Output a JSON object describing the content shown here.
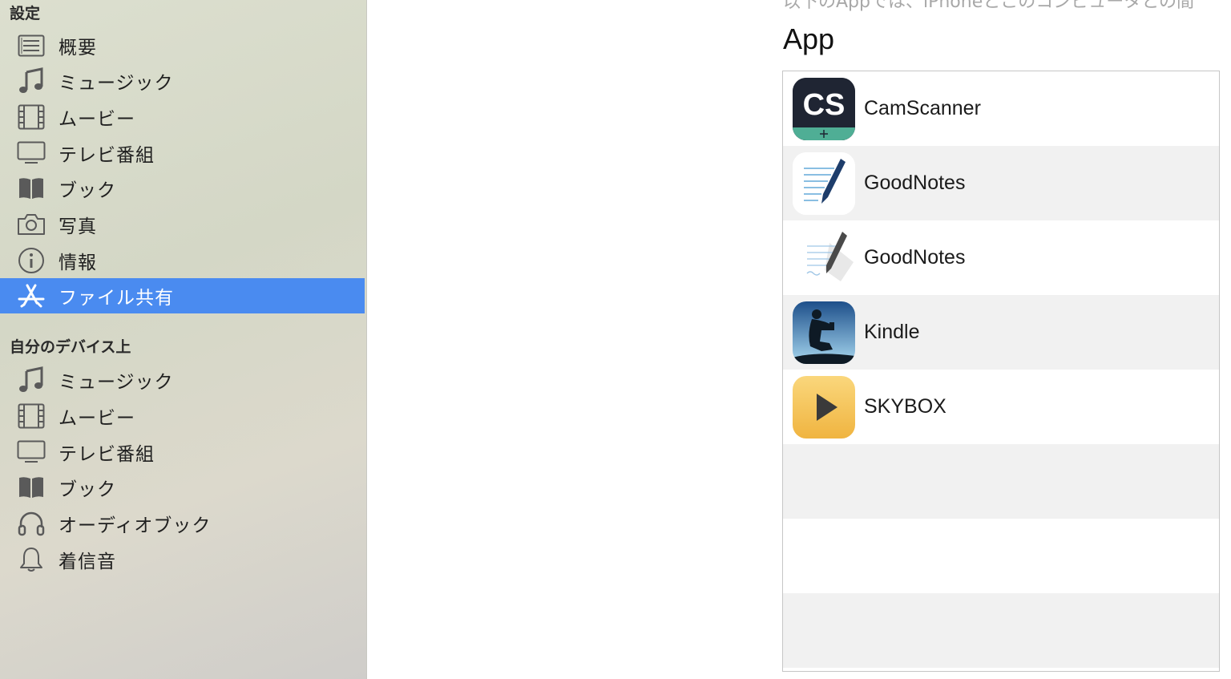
{
  "sidebar": {
    "settings_header": "設定",
    "settings_items": [
      {
        "label": "概要",
        "icon": "list-icon"
      },
      {
        "label": "ミュージック",
        "icon": "music-note-icon"
      },
      {
        "label": "ムービー",
        "icon": "film-icon"
      },
      {
        "label": "テレビ番組",
        "icon": "tv-icon"
      },
      {
        "label": "ブック",
        "icon": "book-icon"
      },
      {
        "label": "写真",
        "icon": "camera-icon"
      },
      {
        "label": "情報",
        "icon": "info-icon"
      },
      {
        "label": "ファイル共有",
        "icon": "app-store-icon",
        "selected": true
      }
    ],
    "device_header": "自分のデバイス上",
    "device_items": [
      {
        "label": "ミュージック",
        "icon": "music-note-icon"
      },
      {
        "label": "ムービー",
        "icon": "film-icon"
      },
      {
        "label": "テレビ番組",
        "icon": "tv-icon"
      },
      {
        "label": "ブック",
        "icon": "book-icon"
      },
      {
        "label": "オーディオブック",
        "icon": "headphones-icon"
      },
      {
        "label": "着信音",
        "icon": "bell-icon"
      }
    ]
  },
  "main": {
    "cut_off_text": "以下のAppでは、iPhoneとこのコンピュータとの間",
    "app_heading": "App",
    "apps": [
      {
        "name": "CamScanner",
        "icon": "camscanner-icon"
      },
      {
        "name": "GoodNotes",
        "icon": "goodnotes-icon"
      },
      {
        "name": "GoodNotes",
        "icon": "goodnotes-legacy-icon"
      },
      {
        "name": "Kindle",
        "icon": "kindle-icon"
      },
      {
        "name": "SKYBOX",
        "icon": "skybox-icon"
      }
    ]
  },
  "colors": {
    "selection": "#4a8bf0",
    "row_alt": "#f1f1f1"
  }
}
